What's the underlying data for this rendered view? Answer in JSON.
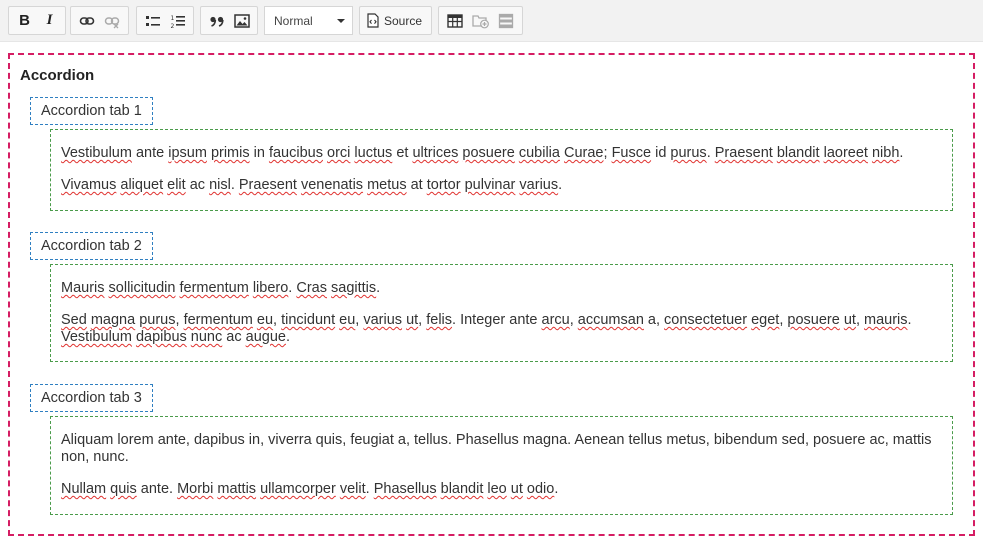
{
  "toolbar": {
    "format_value": "Normal",
    "source_label": "Source",
    "bold_label": "B",
    "italic_label": "I",
    "icons": [
      "bold",
      "italic",
      "link",
      "unlink",
      "bulleted-list",
      "numbered-list",
      "blockquote",
      "image",
      "format-dropdown",
      "source",
      "table",
      "insert-accordion-tab",
      "accordion"
    ]
  },
  "accordion": {
    "title": "Accordion",
    "tabs": [
      {
        "label": "Accordion tab 1",
        "paragraphs": [
          "Vestibulum ante ipsum primis in faucibus orci luctus et ultrices posuere cubilia Curae; Fusce id purus. Praesent blandit laoreet nibh.",
          "Vivamus aliquet elit ac nisl. Praesent venenatis metus at tortor pulvinar varius."
        ]
      },
      {
        "label": "Accordion tab 2",
        "paragraphs": [
          "Mauris sollicitudin fermentum libero. Cras sagittis.",
          "Sed magna purus, fermentum eu, tincidunt eu, varius ut, felis. Integer ante arcu, accumsan a, consectetuer eget, posuere ut, mauris. Vestibulum dapibus nunc ac augue."
        ]
      },
      {
        "label": "Accordion tab 3",
        "paragraphs": [
          "Aliquam lorem ante, dapibus in, viverra quis, feugiat a, tellus. Phasellus magna. Aenean tellus metus, bibendum sed, posuere ac, mattis non, nunc.",
          "Nullam quis ante. Morbi mattis ullamcorper velit. Phasellus blandit leo ut odio."
        ]
      }
    ]
  },
  "colors": {
    "editor_border": "#d51d63",
    "tab_border": "#2f7fc1",
    "panel_border": "#4a9b4a",
    "spellcheck": "#e0322f"
  }
}
